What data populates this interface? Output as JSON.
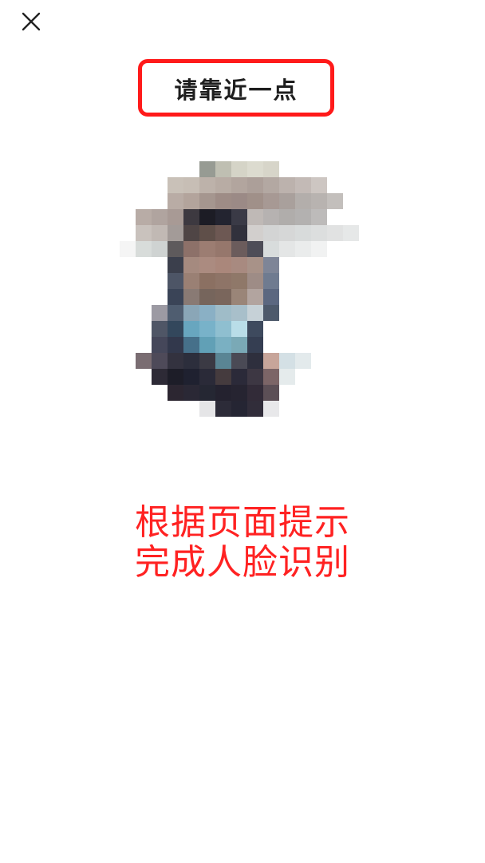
{
  "prompt": {
    "text": "请靠近一点"
  },
  "hint": {
    "line1": "根据页面提示",
    "line2": "完成人脸识别"
  },
  "colors": {
    "prompt_border": "#ff1a1a",
    "hint_text": "#ff2222"
  },
  "icons": {
    "close": "close-icon"
  }
}
